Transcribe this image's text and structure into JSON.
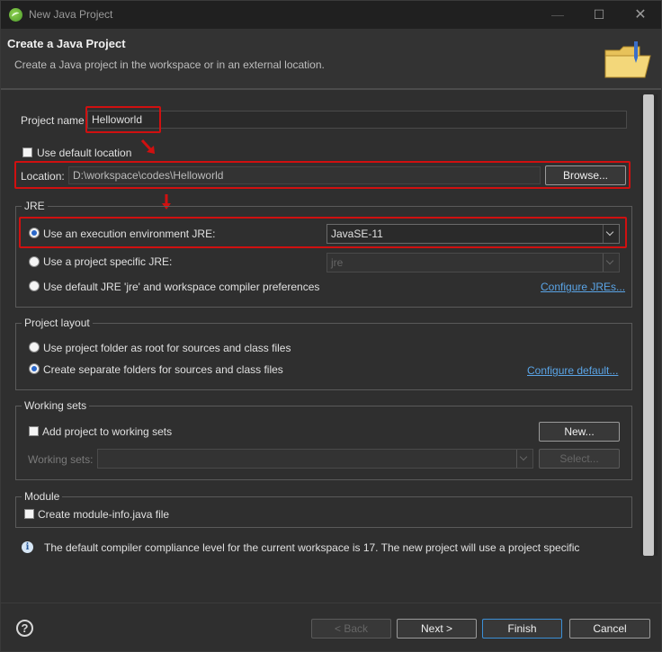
{
  "window": {
    "title": "New Java Project",
    "controls": {
      "minimize": "—",
      "maximize": "☐",
      "close": "✕"
    }
  },
  "header": {
    "title": "Create a Java Project",
    "subtitle": "Create a Java project in the workspace or in an external location."
  },
  "project": {
    "name_label": "Project name",
    "name_value": "Helloworld",
    "use_default_location_label": "Use default location",
    "use_default_location_checked": false,
    "location_label": "Location:",
    "location_value": "D:\\workspace\\codes\\Helloworld",
    "browse_label": "Browse..."
  },
  "jre": {
    "group_title": "JRE",
    "options": [
      {
        "label": "Use an execution environment JRE:",
        "selected": true
      },
      {
        "label": "Use a project specific JRE:",
        "selected": false
      },
      {
        "label": "Use default JRE 'jre' and workspace compiler preferences",
        "selected": false
      }
    ],
    "execution_env_value": "JavaSE-11",
    "project_specific_value": "jre",
    "configure_link": "Configure JREs..."
  },
  "layout": {
    "group_title": "Project layout",
    "options": [
      {
        "label": "Use project folder as root for sources and class files",
        "selected": false
      },
      {
        "label": "Create separate folders for sources and class files",
        "selected": true
      }
    ],
    "configure_link": "Configure default..."
  },
  "working_sets": {
    "group_title": "Working sets",
    "add_label": "Add project to working sets",
    "add_checked": false,
    "new_label": "New...",
    "sets_label": "Working sets:",
    "select_label": "Select..."
  },
  "module": {
    "group_title": "Module",
    "create_label": "Create module-info.java file",
    "create_checked": false
  },
  "info_message": "The default compiler compliance level for the current workspace is 17. The new project will use a project specific",
  "footer": {
    "back_label": "< Back",
    "next_label": "Next >",
    "finish_label": "Finish",
    "cancel_label": "Cancel"
  },
  "icons": {
    "app": "eclipse-icon",
    "header": "folder-icon",
    "info": "info-icon",
    "help": "help-icon"
  },
  "colors": {
    "highlight": "#d01010",
    "link": "#5aa4e6",
    "focus": "#3b8fd6"
  }
}
